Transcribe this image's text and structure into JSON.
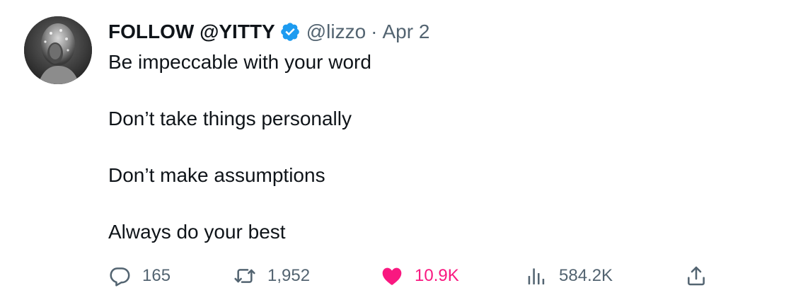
{
  "tweet": {
    "author": {
      "display_name": "FOLLOW @YITTY",
      "handle": "@lizzo",
      "verified": true,
      "avatar_icon": "avatar-photo"
    },
    "separator": "·",
    "date": "Apr 2",
    "lines": [
      "Be impeccable with your word",
      "Don’t take things personally",
      "Don’t make assumptions",
      "Always do your best"
    ],
    "actions": {
      "replies": {
        "icon": "reply-icon",
        "count": "165"
      },
      "retweets": {
        "icon": "retweet-icon",
        "count": "1,952"
      },
      "likes": {
        "icon": "heart-icon",
        "count": "10.9K",
        "liked": true
      },
      "views": {
        "icon": "views-icon",
        "count": "584.2K"
      },
      "share": {
        "icon": "share-icon"
      }
    }
  },
  "colors": {
    "text_primary": "#0f1419",
    "text_secondary": "#536471",
    "verified_blue": "#1d9bf0",
    "like_pink": "#f91880"
  }
}
